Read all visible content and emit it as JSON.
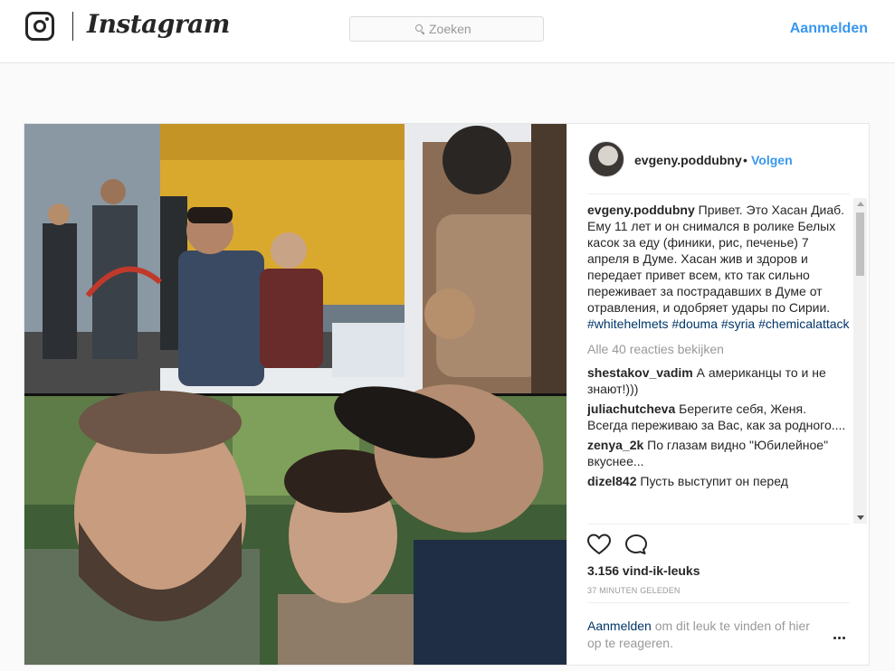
{
  "header": {
    "brand": "Instagram",
    "search_placeholder": "Zoeken",
    "login_label": "Aanmelden"
  },
  "post": {
    "author": "evgeny.poddubny",
    "follow_separator": "•",
    "follow_label": "Volgen",
    "caption": {
      "username": "evgeny.poddubny",
      "text": "Привет. Это Хасан Диаб. Ему 11 лет и он снимался в ролике Белых касок за еду (финики, рис, печенье) 7 апреля в Думе. Хасан жив и здоров и передает привет всем, кто так сильно переживает за пострадавших в Думе от отравления, и одобряет удары по Сирии.",
      "hashtags": [
        "#whitehelmets",
        "#douma",
        "#syria",
        "#chemicalattack"
      ]
    },
    "view_all_comments": "Alle 40 reacties bekijken",
    "comments": [
      {
        "username": "shestakov_vadim",
        "text": "А американцы то и не знают!)))"
      },
      {
        "username": "juliachutcheva",
        "text": "Берегите себя, Женя. Всегда переживаю за Вас, как за родного...."
      },
      {
        "username": "zenya_2k",
        "text": "По глазам видно \"Юбилейное\" вкуснее..."
      },
      {
        "username": "dizel842",
        "text": "Пусть выступит он перед"
      }
    ],
    "likes": "3.156 vind-ik-leuks",
    "timestamp": "37 MINUTEN GELEDEN",
    "login_prompt": {
      "link": "Aanmelden",
      "text": " om dit leuk te vinden of hier op te reageren."
    }
  },
  "icons": {
    "instagram": "instagram-glyph-icon",
    "search": "search-icon",
    "like": "heart-outline-icon",
    "comment": "comment-bubble-icon",
    "more": "more-options-icon"
  },
  "colors": {
    "accent": "#3897f0",
    "link_dark": "#003569",
    "text": "#262626",
    "muted": "#999999"
  }
}
